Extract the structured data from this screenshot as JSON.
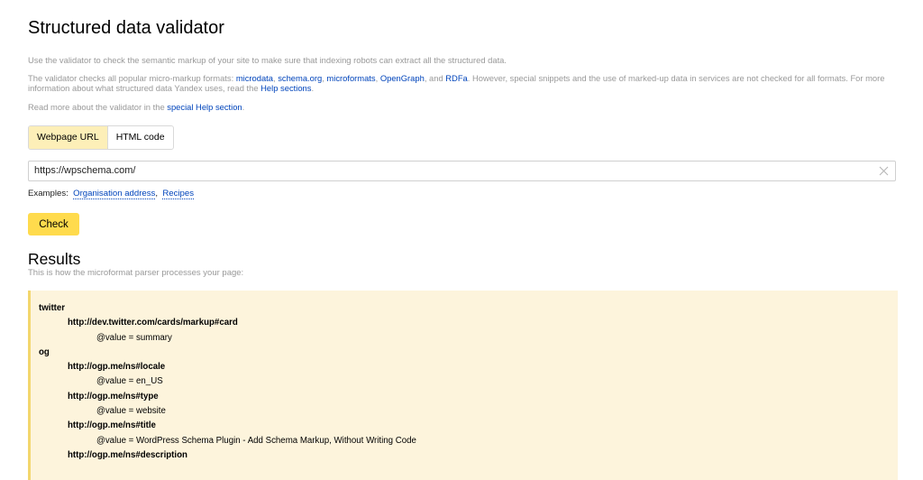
{
  "page_title": "Structured data validator",
  "description": {
    "line1": "Use the validator to check the semantic markup of your site to make sure that indexing robots can extract all the structured data.",
    "line2_prefix": "The validator checks all popular micro-markup formats: ",
    "formats": [
      "microdata",
      "schema.org",
      "microformats",
      "OpenGraph",
      "RDFa"
    ],
    "sep_and": ", and ",
    "line2_suffix": ". However, special snippets and the use of marked-up data in services are not checked for all formats. For more information about what structured data Yandex uses, read the ",
    "help_link": "Help sections",
    "line3_prefix": "Read more about the validator in the ",
    "special_help_link": "special Help section"
  },
  "tabs": [
    {
      "label": "Webpage URL",
      "active": true
    },
    {
      "label": "HTML code",
      "active": false
    }
  ],
  "url_input": {
    "value": "https://wpschema.com/"
  },
  "examples": {
    "label": "Examples:",
    "items": [
      "Organisation address",
      "Recipes"
    ]
  },
  "check_button": "Check",
  "results": {
    "title": "Results",
    "subtitle": "This is how the microformat parser processes your page:",
    "tree": [
      {
        "level": 0,
        "text": "twitter"
      },
      {
        "level": 1,
        "text": "http://dev.twitter.com/cards/markup#card"
      },
      {
        "level": 2,
        "text": "@value = summary"
      },
      {
        "level": 0,
        "text": "og"
      },
      {
        "level": 1,
        "text": "http://ogp.me/ns#locale"
      },
      {
        "level": 2,
        "text": "@value = en_US"
      },
      {
        "level": 1,
        "text": "http://ogp.me/ns#type"
      },
      {
        "level": 2,
        "text": "@value = website"
      },
      {
        "level": 1,
        "text": "http://ogp.me/ns#title"
      },
      {
        "level": 2,
        "text": "@value = WordPress Schema Plugin - Add Schema Markup, Without Writing Code"
      },
      {
        "level": 1,
        "text": "http://ogp.me/ns#description"
      }
    ]
  },
  "colors": {
    "accent_yellow": "#ffdb4d",
    "tab_active": "#fdefb8",
    "panel_bg": "#fdf4dc",
    "panel_border": "#f3d66d",
    "link": "#0044bb"
  }
}
